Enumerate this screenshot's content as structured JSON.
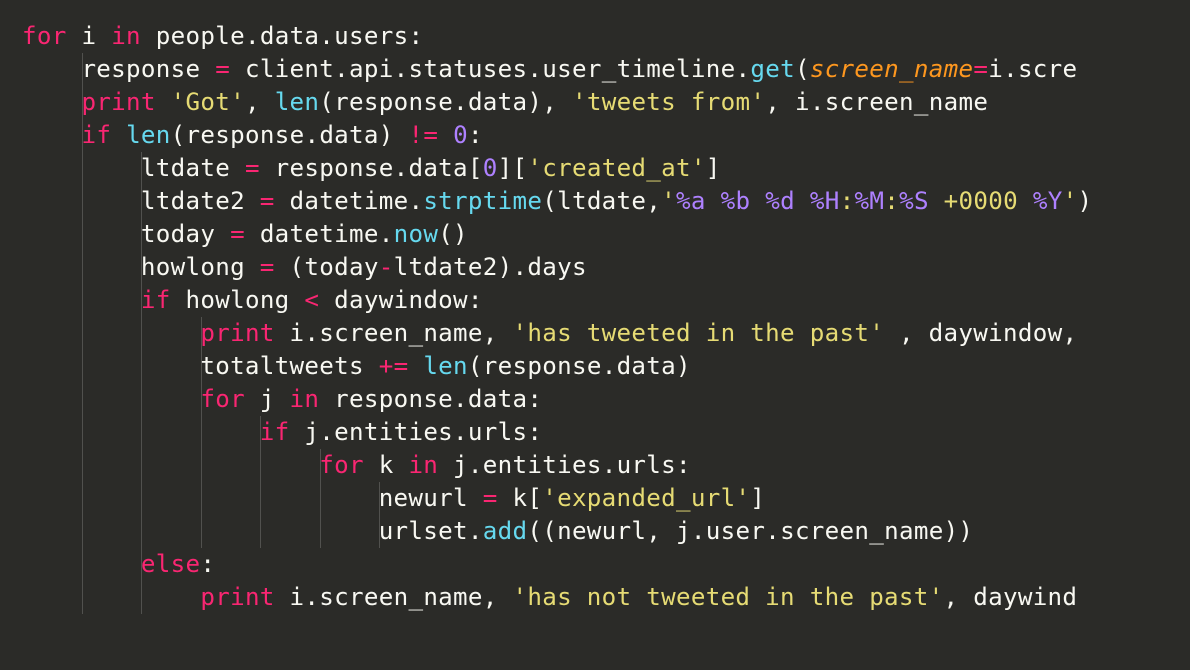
{
  "language": "python",
  "theme": "monokai",
  "background": "#2b2b28",
  "colors": {
    "keyword": "#f92672",
    "identifier": "#f8f8f2",
    "builtin": "#66d9ef",
    "string": "#e6db74",
    "number": "#ae81ff",
    "operator": "#f92672",
    "argument": "#fd971f",
    "escape": "#ae81ff"
  },
  "indent_width_spaces": 4,
  "code_lines": [
    "for i in people.data.users:",
    "    response = client.api.statuses.user_timeline.get(screen_name=i.scre",
    "    print 'Got', len(response.data), 'tweets from', i.screen_name",
    "    if len(response.data) != 0:",
    "        ltdate = response.data[0]['created_at']",
    "        ltdate2 = datetime.strptime(ltdate,'%a %b %d %H:%M:%S +0000 %Y')",
    "        today = datetime.now()",
    "        howlong = (today-ltdate2).days",
    "        if howlong < daywindow:",
    "            print i.screen_name, 'has tweeted in the past' , daywindow,",
    "            totaltweets += len(response.data)",
    "            for j in response.data:",
    "                if j.entities.urls:",
    "                    for k in j.entities.urls:",
    "                        newurl = k['expanded_url']",
    "                        urlset.add((newurl, j.user.screen_name))",
    "        else:",
    "            print i.screen_name, 'has not tweeted in the past', daywind"
  ],
  "tokens": [
    [
      [
        "kw",
        "for"
      ],
      [
        "id",
        " i "
      ],
      [
        "kw",
        "in"
      ],
      [
        "id",
        " people"
      ],
      [
        "punc",
        "."
      ],
      [
        "id",
        "data"
      ],
      [
        "punc",
        "."
      ],
      [
        "id",
        "users"
      ],
      [
        "punc",
        ":"
      ]
    ],
    [
      [
        "id",
        "    response "
      ],
      [
        "op",
        "="
      ],
      [
        "id",
        " client"
      ],
      [
        "punc",
        "."
      ],
      [
        "id",
        "api"
      ],
      [
        "punc",
        "."
      ],
      [
        "id",
        "statuses"
      ],
      [
        "punc",
        "."
      ],
      [
        "id",
        "user_timeline"
      ],
      [
        "punc",
        "."
      ],
      [
        "fn",
        "get"
      ],
      [
        "punc",
        "("
      ],
      [
        "arg",
        "screen_name"
      ],
      [
        "op",
        "="
      ],
      [
        "id",
        "i"
      ],
      [
        "punc",
        "."
      ],
      [
        "id",
        "scre"
      ]
    ],
    [
      [
        "id",
        "    "
      ],
      [
        "kw",
        "print"
      ],
      [
        "id",
        " "
      ],
      [
        "str",
        "'Got'"
      ],
      [
        "punc",
        ", "
      ],
      [
        "fn",
        "len"
      ],
      [
        "punc",
        "("
      ],
      [
        "id",
        "response"
      ],
      [
        "punc",
        "."
      ],
      [
        "id",
        "data"
      ],
      [
        "punc",
        ")"
      ],
      [
        "punc",
        ", "
      ],
      [
        "str",
        "'tweets from'"
      ],
      [
        "punc",
        ", "
      ],
      [
        "id",
        "i"
      ],
      [
        "punc",
        "."
      ],
      [
        "id",
        "screen_name"
      ]
    ],
    [
      [
        "id",
        "    "
      ],
      [
        "kw",
        "if"
      ],
      [
        "id",
        " "
      ],
      [
        "fn",
        "len"
      ],
      [
        "punc",
        "("
      ],
      [
        "id",
        "response"
      ],
      [
        "punc",
        "."
      ],
      [
        "id",
        "data"
      ],
      [
        "punc",
        ") "
      ],
      [
        "op",
        "!="
      ],
      [
        "id",
        " "
      ],
      [
        "num",
        "0"
      ],
      [
        "punc",
        ":"
      ]
    ],
    [
      [
        "id",
        "        ltdate "
      ],
      [
        "op",
        "="
      ],
      [
        "id",
        " response"
      ],
      [
        "punc",
        "."
      ],
      [
        "id",
        "data"
      ],
      [
        "punc",
        "["
      ],
      [
        "num",
        "0"
      ],
      [
        "punc",
        "]["
      ],
      [
        "str",
        "'created_at'"
      ],
      [
        "punc",
        "]"
      ]
    ],
    [
      [
        "id",
        "        ltdate2 "
      ],
      [
        "op",
        "="
      ],
      [
        "id",
        " datetime"
      ],
      [
        "punc",
        "."
      ],
      [
        "fn",
        "strptime"
      ],
      [
        "punc",
        "("
      ],
      [
        "id",
        "ltdate"
      ],
      [
        "punc",
        ","
      ],
      [
        "str",
        "'"
      ],
      [
        "escp",
        "%a"
      ],
      [
        "str",
        " "
      ],
      [
        "escp",
        "%b"
      ],
      [
        "str",
        " "
      ],
      [
        "escp",
        "%d"
      ],
      [
        "str",
        " "
      ],
      [
        "escp",
        "%H"
      ],
      [
        "str",
        ":"
      ],
      [
        "escp",
        "%M"
      ],
      [
        "str",
        ":"
      ],
      [
        "escp",
        "%S"
      ],
      [
        "str",
        " +0000 "
      ],
      [
        "escp",
        "%Y"
      ],
      [
        "str",
        "'"
      ],
      [
        "punc",
        ")"
      ]
    ],
    [
      [
        "id",
        "        today "
      ],
      [
        "op",
        "="
      ],
      [
        "id",
        " datetime"
      ],
      [
        "punc",
        "."
      ],
      [
        "fn",
        "now"
      ],
      [
        "punc",
        "()"
      ]
    ],
    [
      [
        "id",
        "        howlong "
      ],
      [
        "op",
        "="
      ],
      [
        "id",
        " "
      ],
      [
        "punc",
        "("
      ],
      [
        "id",
        "today"
      ],
      [
        "op",
        "-"
      ],
      [
        "id",
        "ltdate2"
      ],
      [
        "punc",
        ")"
      ],
      [
        "punc",
        "."
      ],
      [
        "id",
        "days"
      ]
    ],
    [
      [
        "id",
        "        "
      ],
      [
        "kw",
        "if"
      ],
      [
        "id",
        " howlong "
      ],
      [
        "op",
        "<"
      ],
      [
        "id",
        " daywindow"
      ],
      [
        "punc",
        ":"
      ]
    ],
    [
      [
        "id",
        "            "
      ],
      [
        "kw",
        "print"
      ],
      [
        "id",
        " i"
      ],
      [
        "punc",
        "."
      ],
      [
        "id",
        "screen_name"
      ],
      [
        "punc",
        ", "
      ],
      [
        "str",
        "'has tweeted in the past'"
      ],
      [
        "id",
        " "
      ],
      [
        "punc",
        ", "
      ],
      [
        "id",
        "daywindow"
      ],
      [
        "punc",
        ","
      ]
    ],
    [
      [
        "id",
        "            totaltweets "
      ],
      [
        "op",
        "+="
      ],
      [
        "id",
        " "
      ],
      [
        "fn",
        "len"
      ],
      [
        "punc",
        "("
      ],
      [
        "id",
        "response"
      ],
      [
        "punc",
        "."
      ],
      [
        "id",
        "data"
      ],
      [
        "punc",
        ")"
      ]
    ],
    [
      [
        "id",
        "            "
      ],
      [
        "kw",
        "for"
      ],
      [
        "id",
        " j "
      ],
      [
        "kw",
        "in"
      ],
      [
        "id",
        " response"
      ],
      [
        "punc",
        "."
      ],
      [
        "id",
        "data"
      ],
      [
        "punc",
        ":"
      ]
    ],
    [
      [
        "id",
        "                "
      ],
      [
        "kw",
        "if"
      ],
      [
        "id",
        " j"
      ],
      [
        "punc",
        "."
      ],
      [
        "id",
        "entities"
      ],
      [
        "punc",
        "."
      ],
      [
        "id",
        "urls"
      ],
      [
        "punc",
        ":"
      ]
    ],
    [
      [
        "id",
        "                    "
      ],
      [
        "kw",
        "for"
      ],
      [
        "id",
        " k "
      ],
      [
        "kw",
        "in"
      ],
      [
        "id",
        " j"
      ],
      [
        "punc",
        "."
      ],
      [
        "id",
        "entities"
      ],
      [
        "punc",
        "."
      ],
      [
        "id",
        "urls"
      ],
      [
        "punc",
        ":"
      ]
    ],
    [
      [
        "id",
        "                        newurl "
      ],
      [
        "op",
        "="
      ],
      [
        "id",
        " k"
      ],
      [
        "punc",
        "["
      ],
      [
        "str",
        "'expanded_url'"
      ],
      [
        "punc",
        "]"
      ]
    ],
    [
      [
        "id",
        "                        urlset"
      ],
      [
        "punc",
        "."
      ],
      [
        "fn",
        "add"
      ],
      [
        "punc",
        "(("
      ],
      [
        "id",
        "newurl"
      ],
      [
        "punc",
        ", "
      ],
      [
        "id",
        "j"
      ],
      [
        "punc",
        "."
      ],
      [
        "id",
        "user"
      ],
      [
        "punc",
        "."
      ],
      [
        "id",
        "screen_name"
      ],
      [
        "punc",
        "))"
      ]
    ],
    [
      [
        "id",
        "        "
      ],
      [
        "kw",
        "else"
      ],
      [
        "punc",
        ":"
      ]
    ],
    [
      [
        "id",
        "            "
      ],
      [
        "kw",
        "print"
      ],
      [
        "id",
        " i"
      ],
      [
        "punc",
        "."
      ],
      [
        "id",
        "screen_name"
      ],
      [
        "punc",
        ", "
      ],
      [
        "str",
        "'has not tweeted in the past'"
      ],
      [
        "punc",
        ", "
      ],
      [
        "id",
        "daywind"
      ]
    ]
  ],
  "indent_guides": [
    {
      "col": 4,
      "from_line": 1,
      "to_line": 17
    },
    {
      "col": 8,
      "from_line": 4,
      "to_line": 17
    },
    {
      "col": 12,
      "from_line": 9,
      "to_line": 15
    },
    {
      "col": 16,
      "from_line": 12,
      "to_line": 15
    },
    {
      "col": 20,
      "from_line": 13,
      "to_line": 15
    },
    {
      "col": 24,
      "from_line": 14,
      "to_line": 15
    }
  ]
}
